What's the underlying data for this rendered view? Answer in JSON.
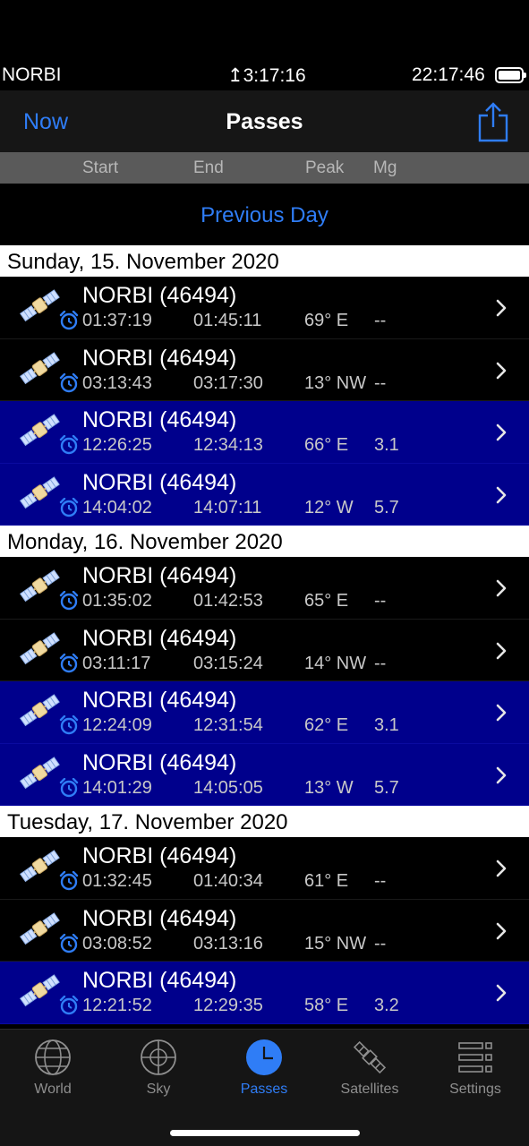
{
  "status": {
    "carrier": "NORBI",
    "timer": "↥3:17:16",
    "clock": "22:17:46"
  },
  "nav": {
    "left_label": "Now",
    "title": "Passes",
    "right_icon": "share-icon"
  },
  "columns": {
    "start": "Start",
    "end": "End",
    "peak": "Peak",
    "mg": "Mg"
  },
  "previous_day": "Previous Day",
  "colors": {
    "accent": "#2f7df6",
    "visible_row": "#00008c",
    "header_bar": "#5a5a5a"
  },
  "sections": [
    {
      "date": "Sunday, 15. November 2020",
      "passes": [
        {
          "name": "NORBI (46494)",
          "start": "01:37:19",
          "end": "01:45:11",
          "peak": "69° E",
          "mg": "--",
          "visible": false
        },
        {
          "name": "NORBI (46494)",
          "start": "03:13:43",
          "end": "03:17:30",
          "peak": "13° NW",
          "mg": "--",
          "visible": false
        },
        {
          "name": "NORBI (46494)",
          "start": "12:26:25",
          "end": "12:34:13",
          "peak": "66° E",
          "mg": "3.1",
          "visible": true
        },
        {
          "name": "NORBI (46494)",
          "start": "14:04:02",
          "end": "14:07:11",
          "peak": "12° W",
          "mg": "5.7",
          "visible": true
        }
      ]
    },
    {
      "date": "Monday, 16. November 2020",
      "passes": [
        {
          "name": "NORBI (46494)",
          "start": "01:35:02",
          "end": "01:42:53",
          "peak": "65° E",
          "mg": "--",
          "visible": false
        },
        {
          "name": "NORBI (46494)",
          "start": "03:11:17",
          "end": "03:15:24",
          "peak": "14° NW",
          "mg": "--",
          "visible": false
        },
        {
          "name": "NORBI (46494)",
          "start": "12:24:09",
          "end": "12:31:54",
          "peak": "62° E",
          "mg": "3.1",
          "visible": true
        },
        {
          "name": "NORBI (46494)",
          "start": "14:01:29",
          "end": "14:05:05",
          "peak": "13° W",
          "mg": "5.7",
          "visible": true
        }
      ]
    },
    {
      "date": "Tuesday, 17. November 2020",
      "passes": [
        {
          "name": "NORBI (46494)",
          "start": "01:32:45",
          "end": "01:40:34",
          "peak": "61° E",
          "mg": "--",
          "visible": false
        },
        {
          "name": "NORBI (46494)",
          "start": "03:08:52",
          "end": "03:13:16",
          "peak": "15° NW",
          "mg": "--",
          "visible": false
        },
        {
          "name": "NORBI (46494)",
          "start": "12:21:52",
          "end": "12:29:35",
          "peak": "58° E",
          "mg": "3.2",
          "visible": true
        }
      ]
    }
  ],
  "tabs": [
    {
      "label": "World",
      "icon": "globe-icon",
      "active": false
    },
    {
      "label": "Sky",
      "icon": "crosshair-icon",
      "active": false
    },
    {
      "label": "Passes",
      "icon": "clock-icon",
      "active": true
    },
    {
      "label": "Satellites",
      "icon": "satellite-icon",
      "active": false
    },
    {
      "label": "Settings",
      "icon": "list-icon",
      "active": false
    }
  ]
}
